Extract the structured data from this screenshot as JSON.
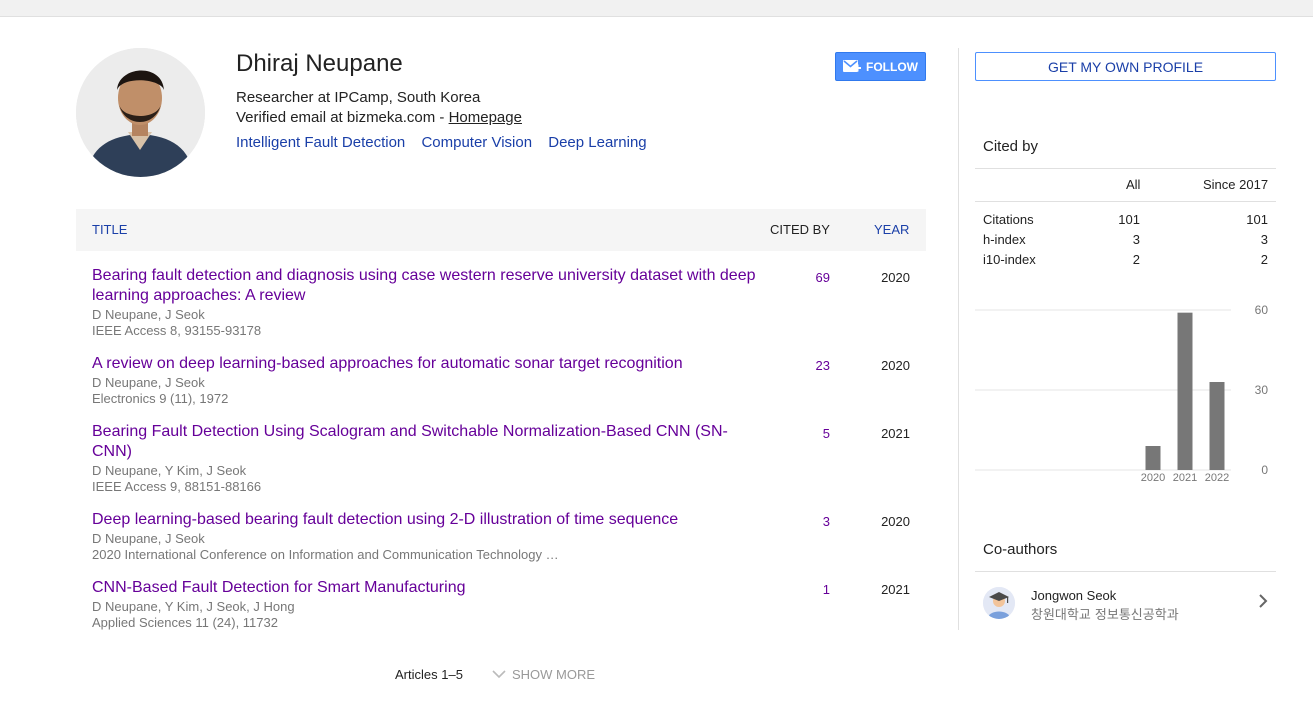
{
  "profile": {
    "name": "Dhiraj Neupane",
    "affiliation": "Researcher at IPCamp, South Korea",
    "email_text": "Verified email at bizmeka.com - ",
    "homepage_label": "Homepage",
    "interests": [
      "Intelligent Fault Detection",
      "Computer Vision",
      "Deep Learning"
    ],
    "follow_label": "FOLLOW"
  },
  "table": {
    "headers": {
      "title": "TITLE",
      "cited_by": "CITED BY",
      "year": "YEAR"
    },
    "rows": [
      {
        "title": "Bearing fault detection and diagnosis using case western reserve university dataset with deep learning approaches: A review",
        "authors": "D Neupane, J Seok",
        "source": "IEEE Access 8, 93155-93178",
        "cited": "69",
        "year": "2020"
      },
      {
        "title": "A review on deep learning-based approaches for automatic sonar target recognition",
        "authors": "D Neupane, J Seok",
        "source": "Electronics 9 (11), 1972",
        "cited": "23",
        "year": "2020"
      },
      {
        "title": "Bearing Fault Detection Using Scalogram and Switchable Normalization-Based CNN (SN-CNN)",
        "authors": "D Neupane, Y Kim, J Seok",
        "source": "IEEE Access 9, 88151-88166",
        "cited": "5",
        "year": "2021"
      },
      {
        "title": "Deep learning-based bearing fault detection using 2-D illustration of time sequence",
        "authors": "D Neupane, J Seok",
        "source": "2020 International Conference on Information and Communication Technology …",
        "cited": "3",
        "year": "2020"
      },
      {
        "title": "CNN-Based Fault Detection for Smart Manufacturing",
        "authors": "D Neupane, Y Kim, J Seok, J Hong",
        "source": "Applied Sciences 11 (24), 11732",
        "cited": "1",
        "year": "2021"
      }
    ],
    "footer_articles": "Articles 1–5",
    "show_more_label": "SHOW MORE"
  },
  "sidebar": {
    "get_profile_label": "GET MY OWN PROFILE",
    "cited_by_title": "Cited by",
    "col_all": "All",
    "col_since": "Since 2017",
    "metrics": [
      {
        "label": "Citations",
        "all": "101",
        "since": "101"
      },
      {
        "label": "h-index",
        "all": "3",
        "since": "3"
      },
      {
        "label": "i10-index",
        "all": "2",
        "since": "2"
      }
    ],
    "coauthors_title": "Co-authors",
    "coauthors": [
      {
        "name": "Jongwon Seok",
        "affiliation": "창원대학교 정보통신공학과"
      }
    ]
  },
  "chart_data": {
    "type": "bar",
    "categories": [
      "2020",
      "2021",
      "2022"
    ],
    "values": [
      9,
      59,
      33
    ],
    "ylim": [
      0,
      60
    ],
    "yticks": [
      "60",
      "30",
      "0"
    ],
    "bar_color": "#777777"
  },
  "colors": {
    "accent": "#4d90fe",
    "link": "#1a3fa8",
    "visited": "#660099"
  }
}
